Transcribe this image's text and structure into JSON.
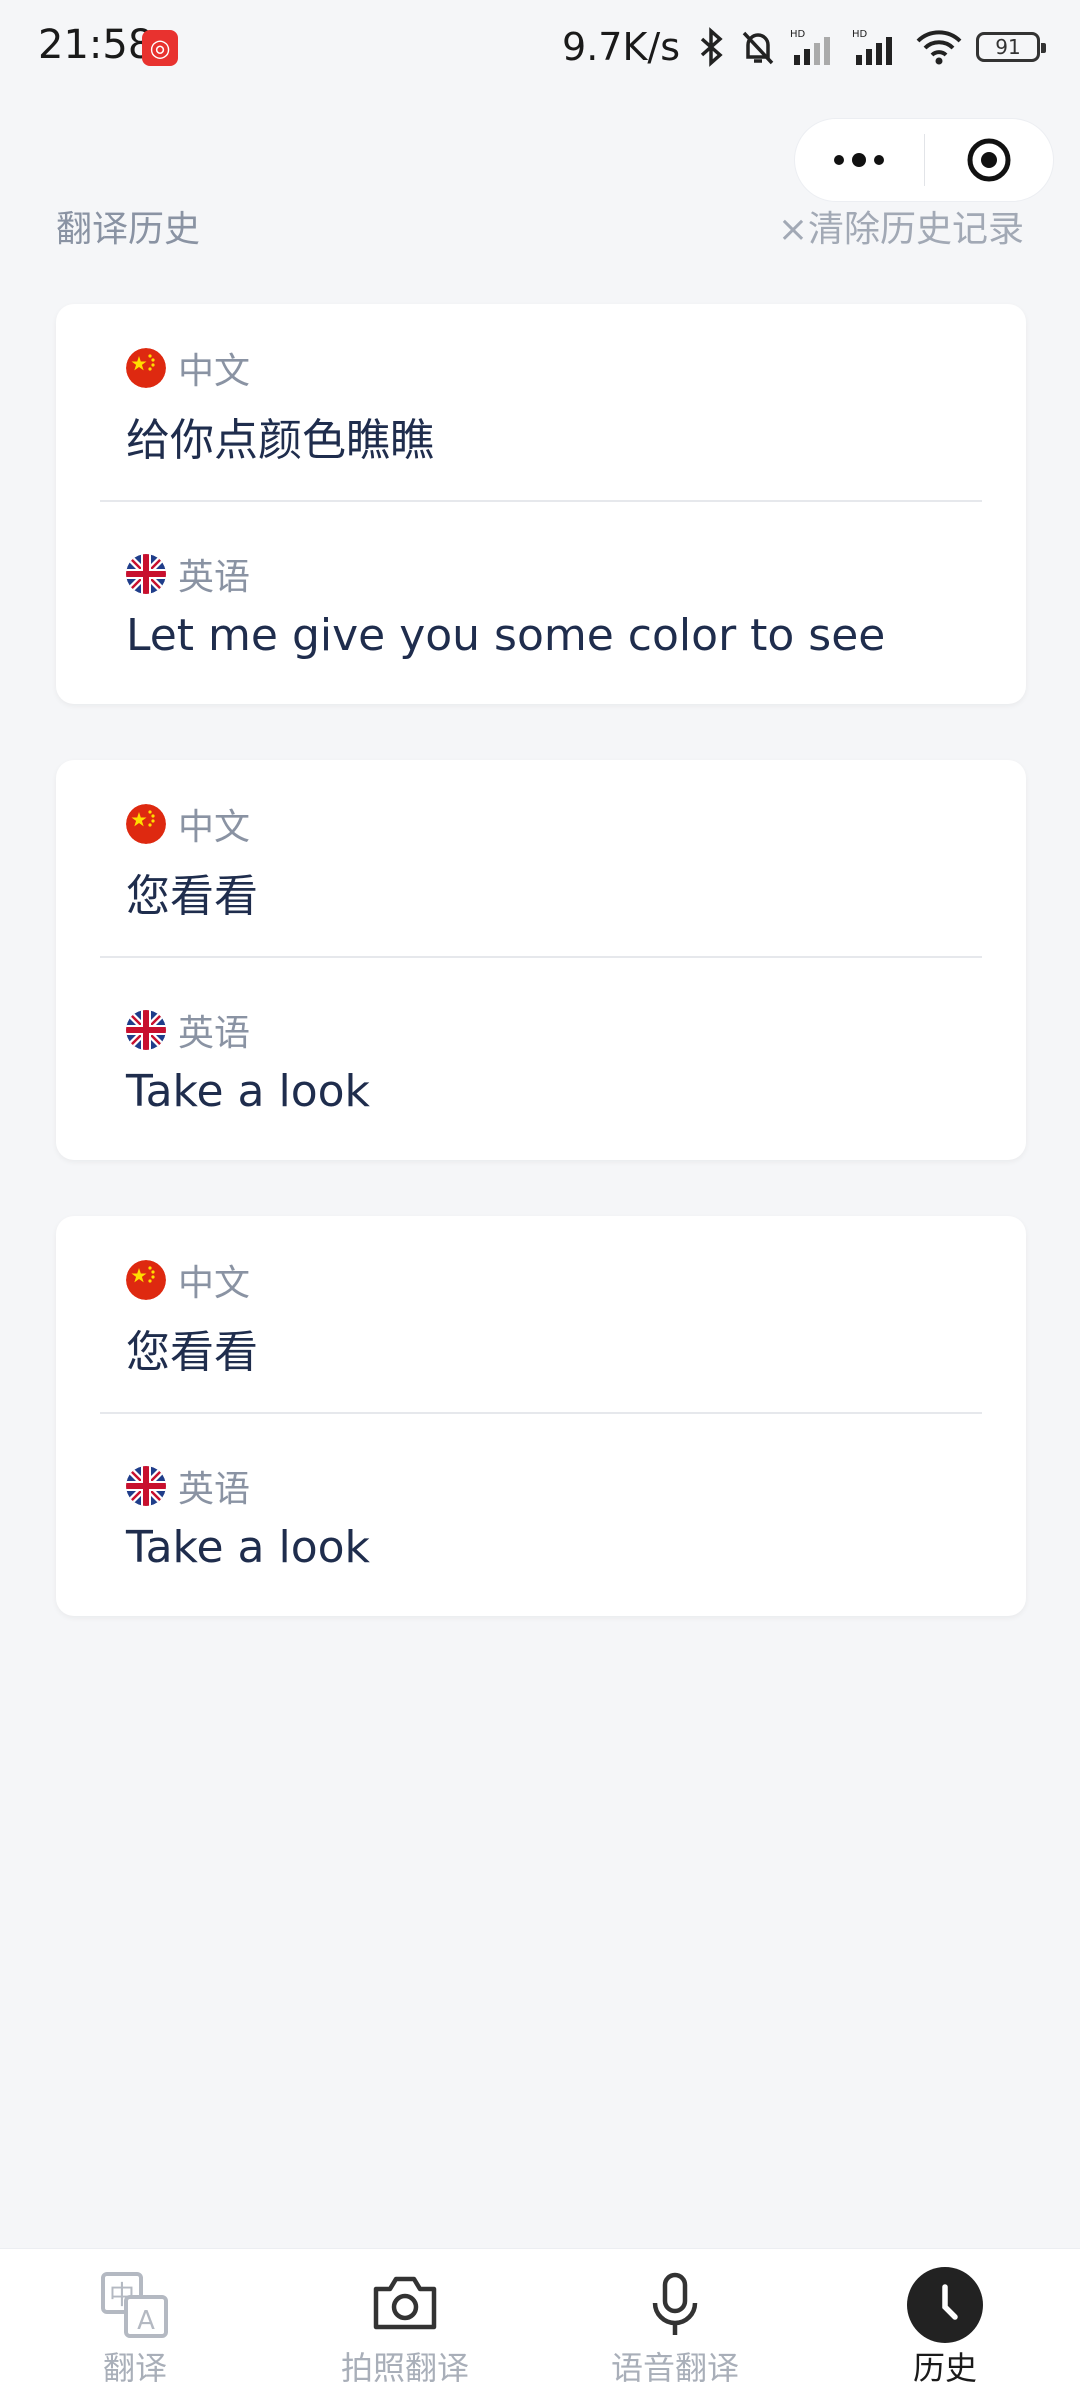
{
  "status": {
    "time": "21:58",
    "net_speed": "9.7K/s",
    "battery": "91"
  },
  "header": {
    "title": "翻译历史",
    "clear_label": "×清除历史记录"
  },
  "history": [
    {
      "source": {
        "lang": "中文",
        "flag": "china-flag-icon",
        "text": "给你点颜色瞧瞧"
      },
      "target": {
        "lang": "英语",
        "flag": "uk-flag-icon",
        "text": "Let me give you some color to see"
      }
    },
    {
      "source": {
        "lang": "中文",
        "flag": "china-flag-icon",
        "text": "您看看"
      },
      "target": {
        "lang": "英语",
        "flag": "uk-flag-icon",
        "text": "Take a look"
      }
    },
    {
      "source": {
        "lang": "中文",
        "flag": "china-flag-icon",
        "text": "您看看"
      },
      "target": {
        "lang": "英语",
        "flag": "uk-flag-icon",
        "text": "Take a look"
      }
    }
  ],
  "tabbar": {
    "items": [
      {
        "label": "翻译",
        "icon": "translate-icon",
        "active": false
      },
      {
        "label": "拍照翻译",
        "icon": "camera-icon",
        "active": false
      },
      {
        "label": "语音翻译",
        "icon": "microphone-icon",
        "active": false
      },
      {
        "label": "历史",
        "icon": "clock-icon",
        "active": true
      }
    ]
  },
  "colors": {
    "background": "#f5f6f8",
    "text_primary": "#1f2d4d",
    "text_secondary": "#8a93a3",
    "tab_inactive": "#a9afb9",
    "tab_active": "#1a1a1a"
  }
}
